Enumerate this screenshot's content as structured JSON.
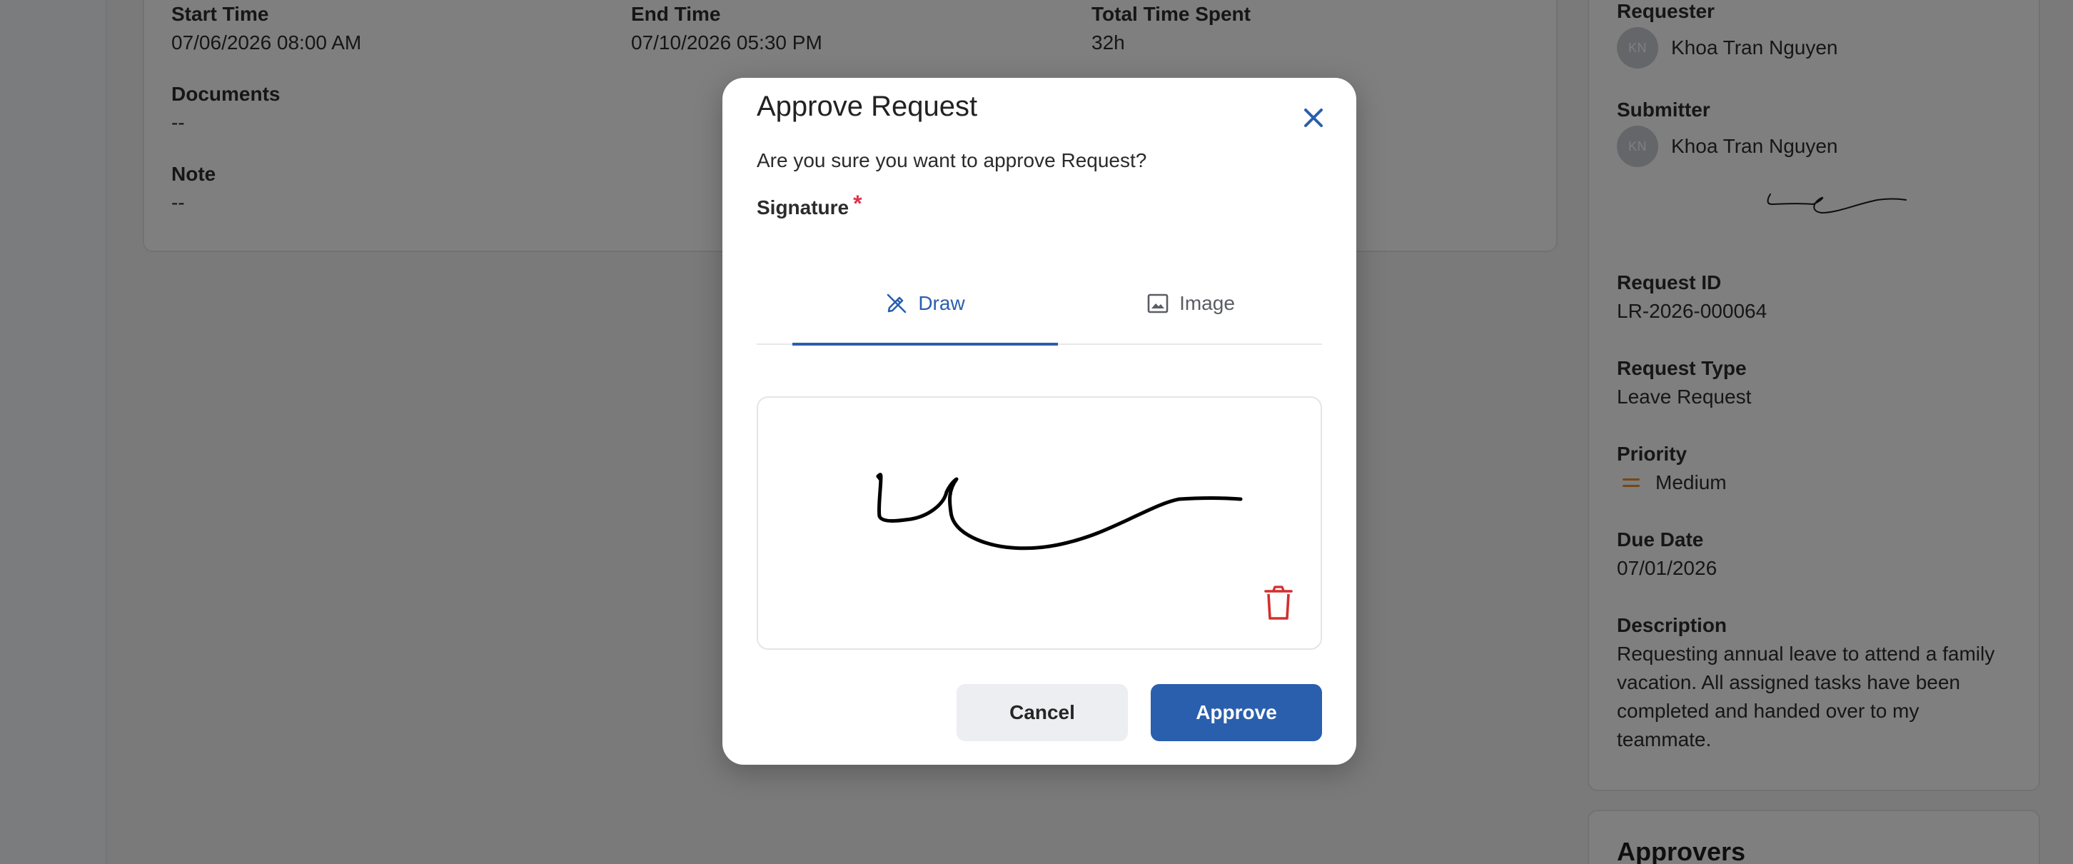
{
  "details": {
    "start_time": {
      "label": "Start Time",
      "value": "07/06/2026 08:00 AM"
    },
    "end_time": {
      "label": "End Time",
      "value": "07/10/2026 05:30 PM"
    },
    "total_time": {
      "label": "Total Time Spent",
      "value": "32h"
    },
    "documents": {
      "label": "Documents",
      "value": "--"
    },
    "note": {
      "label": "Note",
      "value": "--"
    }
  },
  "sidebar": {
    "requester": {
      "label": "Requester",
      "initials": "KN",
      "name": "Khoa Tran Nguyen"
    },
    "submitter": {
      "label": "Submitter",
      "initials": "KN",
      "name": "Khoa Tran Nguyen"
    },
    "request_id": {
      "label": "Request ID",
      "value": "LR-2026-000064"
    },
    "request_type": {
      "label": "Request Type",
      "value": "Leave Request"
    },
    "priority": {
      "label": "Priority",
      "value": "Medium",
      "color": "#e8912c"
    },
    "due_date": {
      "label": "Due Date",
      "value": "07/01/2026"
    },
    "description": {
      "label": "Description",
      "value": "Requesting annual leave to attend a family vacation. All assigned tasks have been completed and handed over to my teammate."
    },
    "approvers_title": "Approvers"
  },
  "modal": {
    "title": "Approve Request",
    "message": "Are you sure you want to approve Request?",
    "signature_label": "Signature",
    "required_mark": "*",
    "tabs": [
      {
        "label": "Draw",
        "icon": "draw-pen-icon",
        "active": true
      },
      {
        "label": "Image",
        "icon": "image-icon",
        "active": false
      }
    ],
    "cancel_label": "Cancel",
    "approve_label": "Approve"
  },
  "colors": {
    "accent": "#2a5fad",
    "danger": "#d32f2f",
    "required": "#e0334f",
    "overlay": "rgba(0,0,0,0.5)"
  }
}
